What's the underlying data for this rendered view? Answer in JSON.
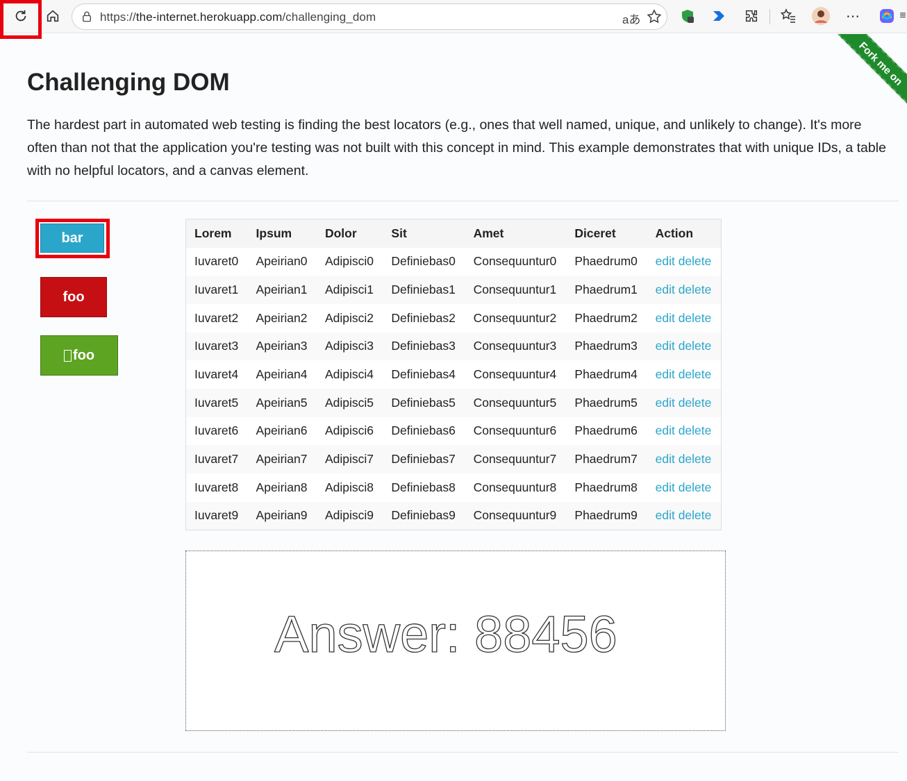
{
  "browser": {
    "url_scheme": "https://",
    "url_host": "the-internet.herokuapp.com",
    "url_path": "/challenging_dom"
  },
  "page": {
    "title": "Challenging DOM",
    "intro": "The hardest part in automated web testing is finding the best locators (e.g., ones that well named, unique, and unlikely to change). It's more often than not that the application you're testing was not built with this concept in mind. This example demonstrates that with unique IDs, a table with no helpful locators, and a canvas element.",
    "ribbon": "Fork me on",
    "buttons": {
      "bar": "bar",
      "foo": "foo",
      "foo2": "\u0000foo"
    },
    "canvas_text": "Answer: 88456"
  },
  "table": {
    "headers": [
      "Lorem",
      "Ipsum",
      "Dolor",
      "Sit",
      "Amet",
      "Diceret",
      "Action"
    ],
    "rows": [
      [
        "Iuvaret0",
        "Apeirian0",
        "Adipisci0",
        "Definiebas0",
        "Consequuntur0",
        "Phaedrum0"
      ],
      [
        "Iuvaret1",
        "Apeirian1",
        "Adipisci1",
        "Definiebas1",
        "Consequuntur1",
        "Phaedrum1"
      ],
      [
        "Iuvaret2",
        "Apeirian2",
        "Adipisci2",
        "Definiebas2",
        "Consequuntur2",
        "Phaedrum2"
      ],
      [
        "Iuvaret3",
        "Apeirian3",
        "Adipisci3",
        "Definiebas3",
        "Consequuntur3",
        "Phaedrum3"
      ],
      [
        "Iuvaret4",
        "Apeirian4",
        "Adipisci4",
        "Definiebas4",
        "Consequuntur4",
        "Phaedrum4"
      ],
      [
        "Iuvaret5",
        "Apeirian5",
        "Adipisci5",
        "Definiebas5",
        "Consequuntur5",
        "Phaedrum5"
      ],
      [
        "Iuvaret6",
        "Apeirian6",
        "Adipisci6",
        "Definiebas6",
        "Consequuntur6",
        "Phaedrum6"
      ],
      [
        "Iuvaret7",
        "Apeirian7",
        "Adipisci7",
        "Definiebas7",
        "Consequuntur7",
        "Phaedrum7"
      ],
      [
        "Iuvaret8",
        "Apeirian8",
        "Adipisci8",
        "Definiebas8",
        "Consequuntur8",
        "Phaedrum8"
      ],
      [
        "Iuvaret9",
        "Apeirian9",
        "Adipisci9",
        "Definiebas9",
        "Consequuntur9",
        "Phaedrum9"
      ]
    ],
    "action_edit": "edit",
    "action_delete": "delete"
  },
  "colors": {
    "bar_button": "#2ba6cb",
    "foo_button": "#c60f13",
    "foo2_button": "#5da423",
    "link": "#2ba6cb",
    "highlight": "#e8000f"
  }
}
